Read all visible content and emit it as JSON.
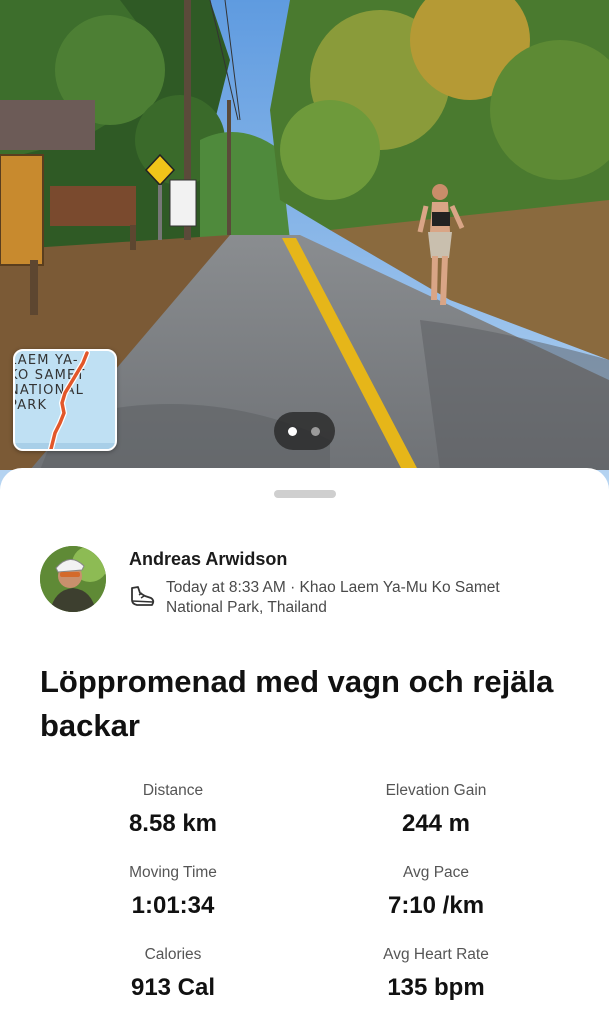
{
  "map": {
    "label": "LAEM YA-\nKO SAMET\nNATIONAL\nPARK"
  },
  "pager": {
    "count": 2,
    "active": 1
  },
  "athlete": {
    "name": "Andreas Arwidson",
    "meta": "Today at 8:33 AM · Khao Laem Ya-Mu Ko Samet National Park, Thailand"
  },
  "activity": {
    "title": "Löppromenad med vagn och rejäla backar"
  },
  "stats": {
    "distance": {
      "label": "Distance",
      "value": "8.58 km"
    },
    "elevation": {
      "label": "Elevation Gain",
      "value": "244 m"
    },
    "moving_time": {
      "label": "Moving Time",
      "value": "1:01:34"
    },
    "avg_pace": {
      "label": "Avg Pace",
      "value": "7:10 /km"
    },
    "calories": {
      "label": "Calories",
      "value": "913 Cal"
    },
    "avg_hr": {
      "label": "Avg Heart Rate",
      "value": "135 bpm"
    }
  },
  "colors": {
    "route": "#e2572a",
    "road_line": "#e6b619",
    "sky": "#8fb9e6"
  }
}
